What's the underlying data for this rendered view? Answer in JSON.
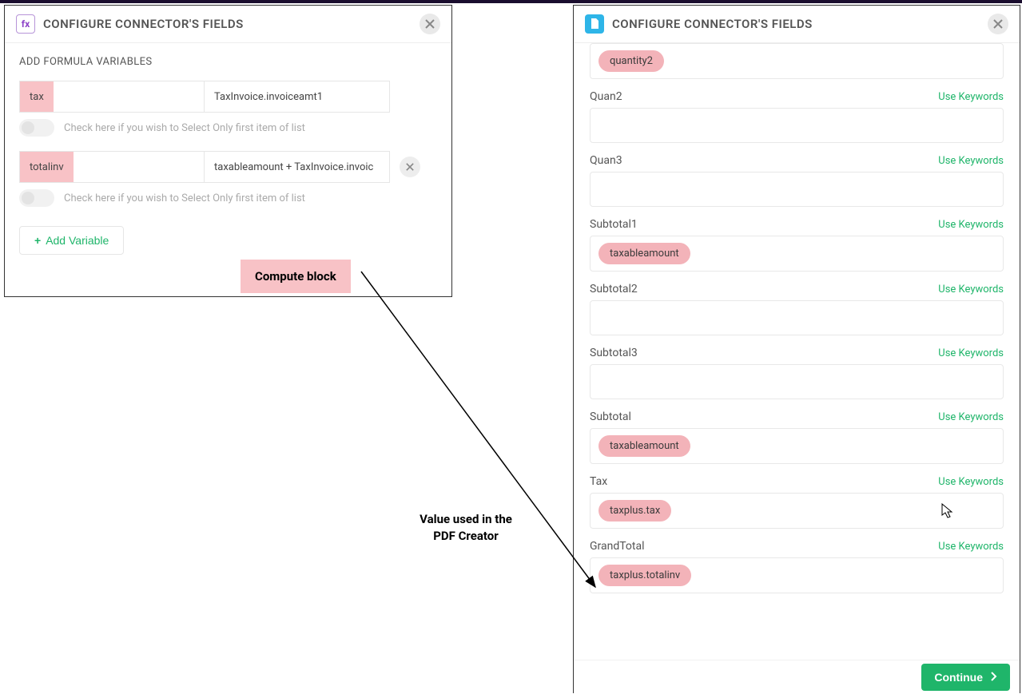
{
  "leftPanel": {
    "title": "CONFIGURE CONNECTOR'S FIELDS",
    "subhead": "ADD FORMULA VARIABLES",
    "vars": [
      {
        "name": "tax",
        "expr": "TaxInvoice.invoiceamt1"
      },
      {
        "name": "totalinv",
        "expr": "taxableamount + TaxInvoice.invoic"
      }
    ],
    "toggleLabel": "Check here if you wish to Select Only first item of list",
    "addVariable": "Add Variable",
    "computeTag": "Compute block"
  },
  "rightPanel": {
    "title": "CONFIGURE CONNECTOR'S FIELDS",
    "useKeywords": "Use Keywords",
    "fields": [
      {
        "label": "",
        "pill": "quantity2",
        "showHead": false
      },
      {
        "label": "Quan2",
        "pill": "",
        "showHead": true
      },
      {
        "label": "Quan3",
        "pill": "",
        "showHead": true
      },
      {
        "label": "Subtotal1",
        "pill": "taxableamount",
        "showHead": true
      },
      {
        "label": "Subtotal2",
        "pill": "",
        "showHead": true
      },
      {
        "label": "Subtotal3",
        "pill": "",
        "showHead": true
      },
      {
        "label": "Subtotal",
        "pill": "taxableamount",
        "showHead": true
      },
      {
        "label": "Tax",
        "pill": "taxplus.tax",
        "showHead": true
      },
      {
        "label": "GrandTotal",
        "pill": "taxplus.totalinv",
        "showHead": true
      }
    ],
    "continue": "Continue"
  },
  "annotations": {
    "pdfCreator": "Value used in the\nPDF Creator"
  }
}
